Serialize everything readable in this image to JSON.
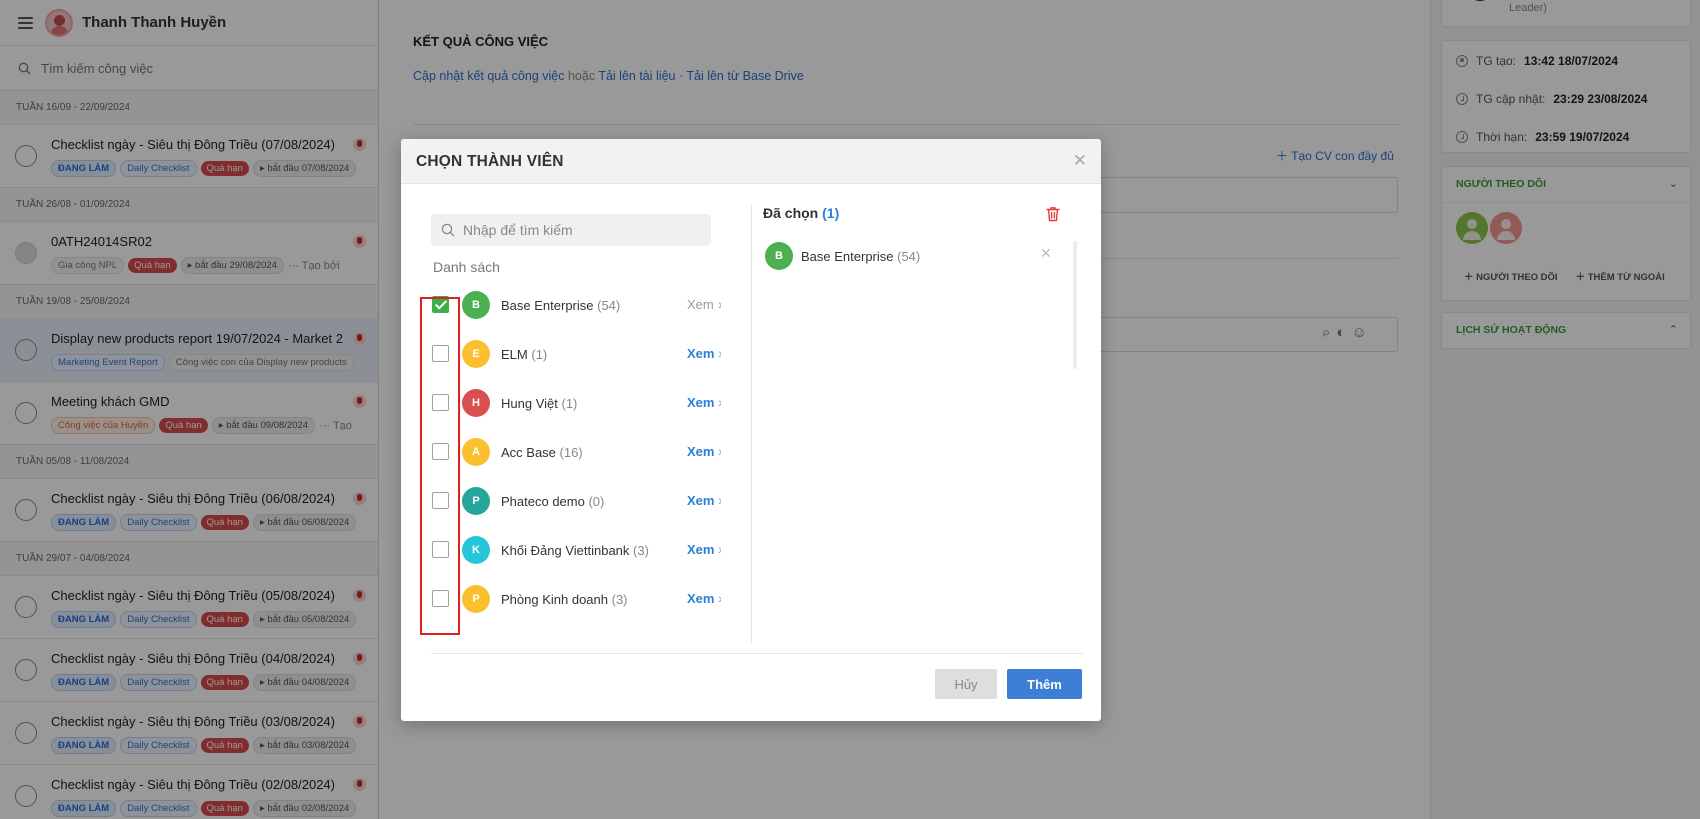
{
  "left_panel": {
    "user_name": "Thanh Thanh Huyền",
    "search_placeholder": "Tìm kiếm công việc",
    "groups": [
      {
        "week": "TUẦN 16/09 - 22/09/2024",
        "tasks": [
          {
            "title": "Checklist ngày - Siêu thị Đông Triều (07/08/2024)",
            "status": "ĐANG LÀM",
            "category": "Daily Checklist",
            "late": "Quá hạn",
            "start": "bắt đầu 07/08/2024"
          }
        ]
      },
      {
        "week": "TUẦN 26/08 - 01/09/2024",
        "tasks": [
          {
            "title": "0ATH24014SR02",
            "category": "Gia công NPL",
            "late": "Quá hạn",
            "start": "bắt đầu 29/08/2024",
            "more": "Tạo bởi"
          }
        ]
      },
      {
        "week": "TUẦN 19/08 - 25/08/2024",
        "tasks": [
          {
            "title": "Display new products report 19/07/2024 - Market 2",
            "category": "Marketing Event Report",
            "parent": "Công việc con của Display new products"
          },
          {
            "title": "Meeting khách GMD",
            "owner": "Công việc của Huyền",
            "late": "Quá hạn",
            "start": "bắt đầu 09/08/2024",
            "more": "Tạo"
          }
        ]
      },
      {
        "week": "TUẦN 05/08 - 11/08/2024",
        "tasks": [
          {
            "title": "Checklist ngày - Siêu thị Đông Triều (06/08/2024)",
            "status": "ĐANG LÀM",
            "category": "Daily Checklist",
            "late": "Quá hạn",
            "start": "bắt đầu 06/08/2024"
          }
        ]
      },
      {
        "week": "TUẦN 29/07 - 04/08/2024",
        "tasks": [
          {
            "title": "Checklist ngày - Siêu thị Đông Triều (05/08/2024)",
            "status": "ĐANG LÀM",
            "category": "Daily Checklist",
            "late": "Quá hạn",
            "start": "bắt đầu 05/08/2024"
          },
          {
            "title": "Checklist ngày - Siêu thị Đông Triều (04/08/2024)",
            "status": "ĐANG LÀM",
            "category": "Daily Checklist",
            "late": "Quá hạn",
            "start": "bắt đầu 04/08/2024"
          },
          {
            "title": "Checklist ngày - Siêu thị Đông Triều (03/08/2024)",
            "status": "ĐANG LÀM",
            "category": "Daily Checklist",
            "late": "Quá hạn",
            "start": "bắt đầu 03/08/2024"
          },
          {
            "title": "Checklist ngày - Siêu thị Đông Triều (02/08/2024)",
            "status": "ĐANG LÀM",
            "category": "Daily Checklist",
            "late": "Quá hạn",
            "start": "bắt đầu 02/08/2024"
          }
        ]
      }
    ]
  },
  "middle": {
    "section_title": "KẾT QUẢ CÔNG VIỆC",
    "update_link": "Cập nhật kết quả công việc",
    "or_text": "hoặc",
    "upload_link": "Tải lên tài liệu",
    "drive_link": "· Tải lên từ Base Drive",
    "create_sub_full": "Tạo CV con đầy đủ"
  },
  "right_panel": {
    "role": "Leader)",
    "created_label": "TG tạo:",
    "created_value": "13:42 18/07/2024",
    "updated_label": "TG cập nhật:",
    "updated_value": "23:29 23/08/2024",
    "deadline_label": "Thời hạn:",
    "deadline_value": "23:59 19/07/2024",
    "followers_title": "NGƯỜI THEO DÕI",
    "add_follower": "NGƯỜI THEO DÕI",
    "add_external": "THÊM TỪ NGOÀI",
    "history_title": "LỊCH SỬ HOẠT ĐỘNG"
  },
  "modal": {
    "title": "CHỌN THÀNH VIÊN",
    "search_placeholder": "Nhập để tìm kiếm",
    "list_title": "Danh sách",
    "view_label": "Xem",
    "items": [
      {
        "initial": "B",
        "name": "Base Enterprise",
        "count": "(54)",
        "color": "#4caf50",
        "checked": true
      },
      {
        "initial": "E",
        "name": "ELM",
        "count": "(1)",
        "color": "#fbc02d",
        "checked": false
      },
      {
        "initial": "H",
        "name": "Hung Việt",
        "count": "(1)",
        "color": "#d94f4f",
        "checked": false
      },
      {
        "initial": "A",
        "name": "Acc Base",
        "count": "(16)",
        "color": "#fbc02d",
        "checked": false
      },
      {
        "initial": "P",
        "name": "Phateco demo",
        "count": "(0)",
        "color": "#26a69a",
        "checked": false
      },
      {
        "initial": "K",
        "name": "Khối Đảng Viettinbank",
        "count": "(3)",
        "color": "#26c6da",
        "checked": false
      },
      {
        "initial": "P",
        "name": "Phòng Kinh doanh",
        "count": "(3)",
        "color": "#fbc02d",
        "checked": false
      }
    ],
    "selected_title": "Đã chọn",
    "selected_count": "(1)",
    "selected": [
      {
        "initial": "B",
        "name": "Base Enterprise",
        "count": "(54)",
        "color": "#4caf50"
      }
    ],
    "cancel_label": "Hủy",
    "add_label": "Thêm"
  }
}
